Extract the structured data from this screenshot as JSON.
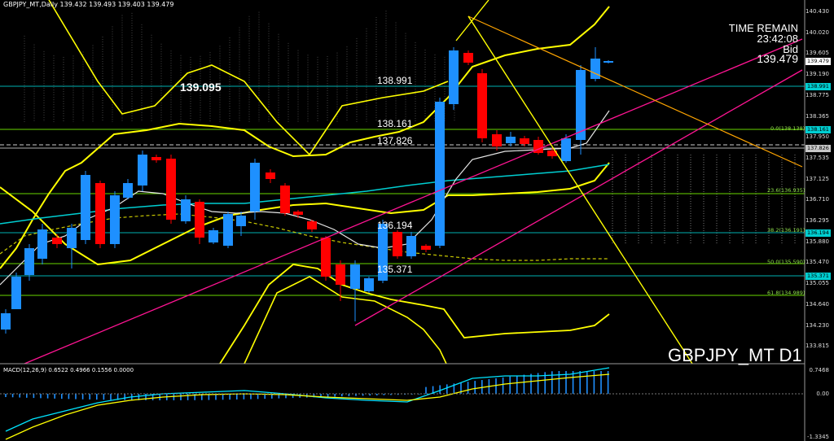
{
  "chart": {
    "header": "GBPJPY_MT,Daily",
    "ohlc": "139.432 139.493 139.403 139.479",
    "symbol_label": "GBPJPY_MT D1",
    "bid_price_label": "139.095",
    "time_remain_label": "TIME REMAIN",
    "time_remain_value": "23:42:08",
    "bid_label": "Bid",
    "bid_value": "139.479"
  },
  "levels": [
    {
      "label": "138.991",
      "price": 138.991
    },
    {
      "label": "138.161",
      "price": 138.161
    },
    {
      "label": "137.826",
      "price": 137.826
    },
    {
      "label": "136.194",
      "price": 136.194
    },
    {
      "label": "135.371",
      "price": 135.371
    }
  ],
  "price_axis": [
    "140.430",
    "140.020",
    "139.605",
    "139.190",
    "138.775",
    "138.365",
    "137.950",
    "137.535",
    "137.125",
    "136.710",
    "136.295",
    "135.880",
    "135.470",
    "135.055",
    "134.640",
    "134.230",
    "133.815"
  ],
  "price_tags": [
    {
      "text": "139.479",
      "kind": "bid"
    },
    {
      "text": "138.991",
      "kind": "level"
    },
    {
      "text": "138.161",
      "kind": "level"
    },
    {
      "text": "137.826",
      "kind": "dark"
    },
    {
      "text": "136.194",
      "kind": "level"
    },
    {
      "text": "135.371",
      "kind": "level"
    }
  ],
  "fib_labels": [
    "0.0(138.138)",
    "23.6(136.935)",
    "38.2(136.191)",
    "50.0(135.590)",
    "61.8(134.989)"
  ],
  "macd": {
    "label": "MACD(12,26,9) 0.6522 0.4966 0.1556 0.0000",
    "axis": [
      "0.7468",
      "0.00",
      "-1.3345"
    ]
  },
  "colors": {
    "background": "#000000",
    "bull": "#1e90ff",
    "bear": "#ff0000",
    "bollinger": "#ffff00",
    "trendline": "#ff1493",
    "fib_fan": "#ffa500",
    "level_line": "#00ced1",
    "fib_text": "#7cfc00",
    "macd_signal": "#00e5ff"
  }
}
